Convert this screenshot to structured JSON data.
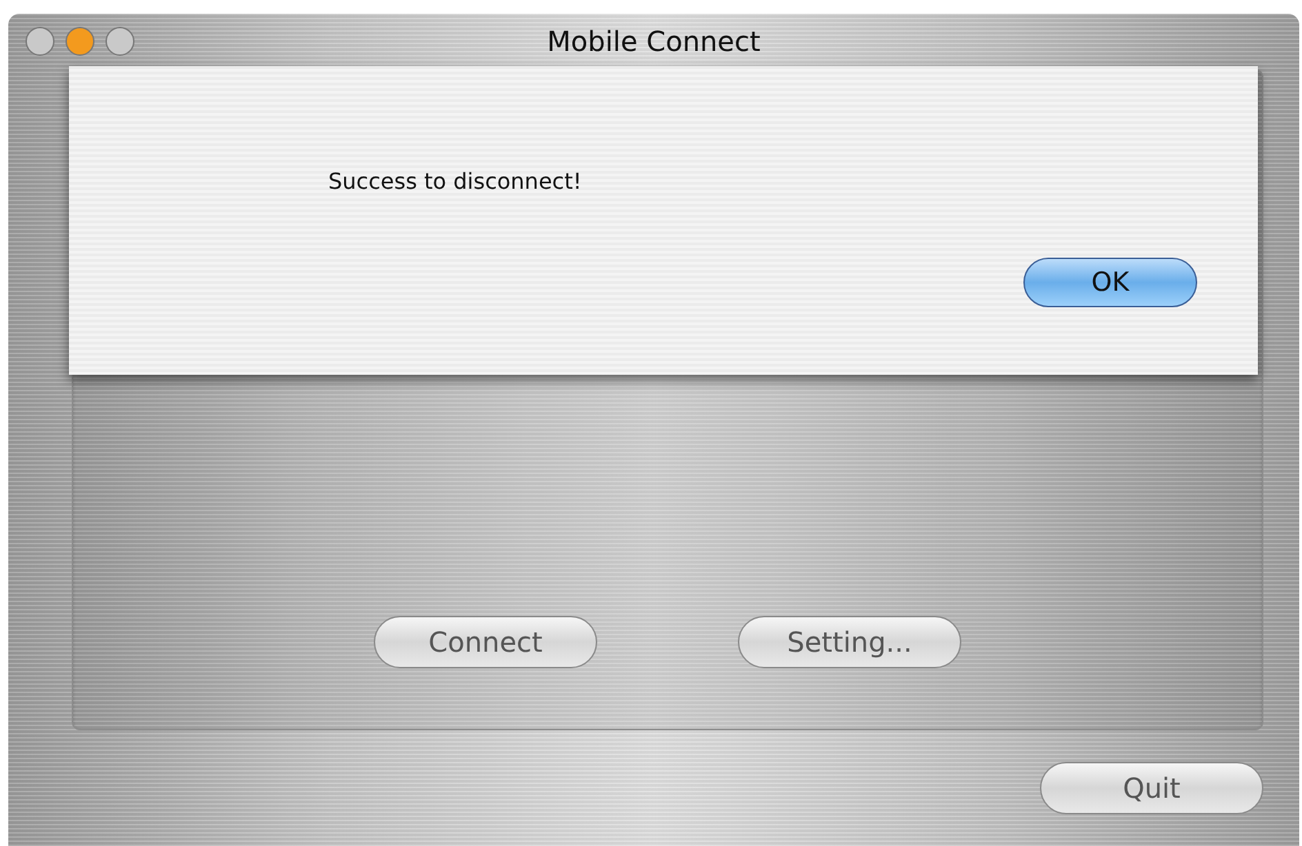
{
  "window": {
    "title": "Mobile Connect"
  },
  "sheet": {
    "message": "Success to disconnect!",
    "button": "OK"
  },
  "panel": {
    "buttons": [
      "Connect",
      "Setting..."
    ]
  },
  "footer": {
    "button": "Quit"
  }
}
